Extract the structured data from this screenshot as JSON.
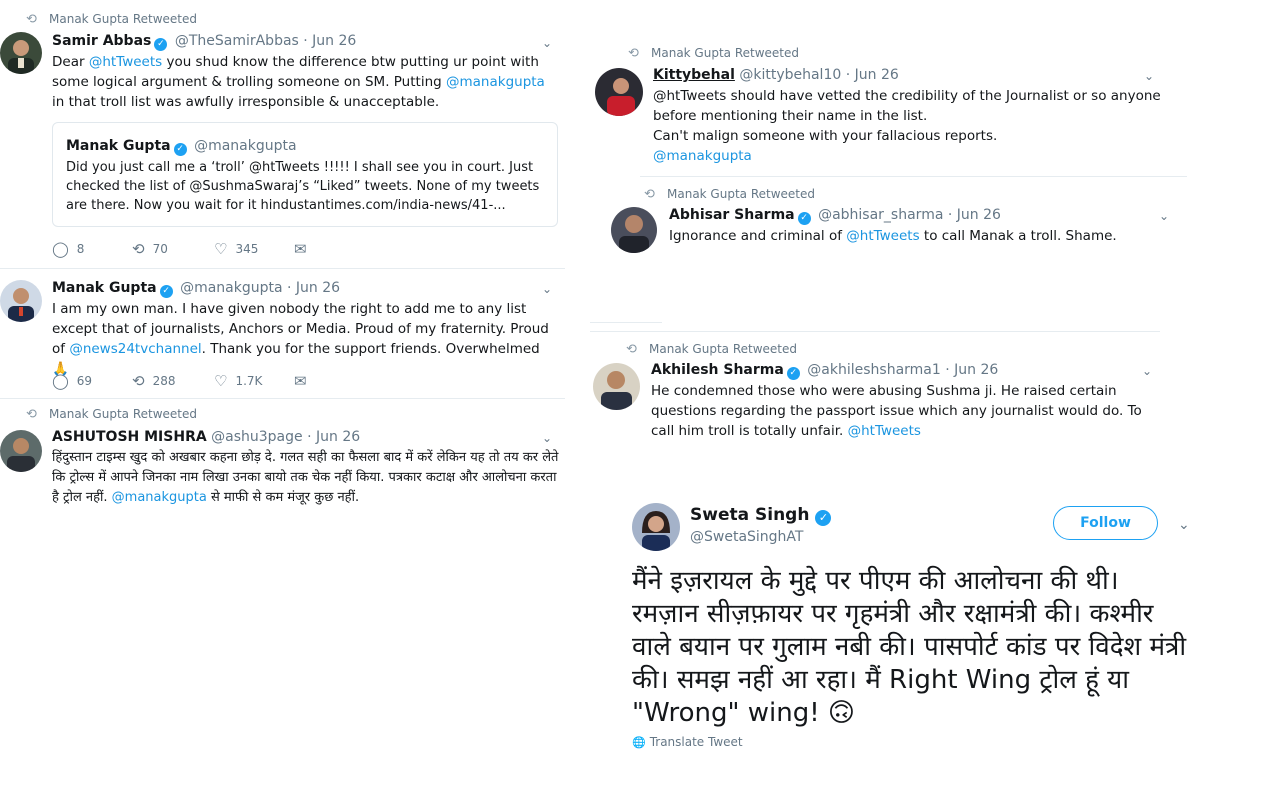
{
  "tweets": [
    {
      "retweet_label": "Manak Gupta Retweeted",
      "name": "Samir Abbas",
      "handle": "@TheSamirAbbas",
      "date": "· Jun 26",
      "text_parts": [
        "Dear ",
        "@htTweets",
        " you shud know the difference btw putting ur point with some logical argument & trolling someone on SM. Putting ",
        "@manakgupta",
        " in that troll list was awfully irresponsible & unacceptable."
      ],
      "quote": {
        "name": "Manak Gupta",
        "handle": "@manakgupta",
        "text": "Did you just call me a ‘troll’ @htTweets !!!!! I shall see you in court. Just checked the list of @SushmaSwaraj’s “Liked” tweets. None of my tweets are there. Now you wait for it  hindustantimes.com/india-news/41-..."
      },
      "replies": "8",
      "retweets": "70",
      "likes": "345"
    },
    {
      "name": "Manak Gupta",
      "handle": "@manakgupta",
      "date": "· Jun 26",
      "text_parts": [
        "I am my own man. I have given nobody the right to add me to any list except that of journalists, Anchors or Media. Proud of my fraternity. Proud of ",
        "@news24tvchannel",
        ". Thank you for the support friends. Overwhelmed 🙏"
      ],
      "replies": "69",
      "retweets": "288",
      "likes": "1.7K"
    },
    {
      "retweet_label": "Manak Gupta Retweeted",
      "name": "ASHUTOSH MISHRA",
      "handle": "@ashu3page",
      "date": "· Jun 26",
      "text_parts": [
        "हिंदुस्तान टाइम्स खुद को अखबार कहना छोड़ दे. गलत सही का फैसला बाद में करें लेकिन यह तो तय कर लेते कि ट्रोल्स में आपने जिनका नाम लिखा उनका बायो तक चेक नहीं किया. पत्रकार कटाक्ष और आलोचना करता है ट्रोल नहीं. ",
        "@manakgupta",
        " से माफी से कम मंजूर कुछ नहीं."
      ]
    },
    {
      "retweet_label": "Manak Gupta Retweeted",
      "name": "Kittybehal",
      "handle": "@kittybehal10",
      "date": "· Jun 26",
      "lines": [
        "@htTweets should have vetted the credibility of the Journalist or so anyone before mentioning their name in the list.",
        "Can't malign someone with your fallacious reports.",
        "@manakgupta"
      ]
    },
    {
      "retweet_label": "Manak Gupta Retweeted",
      "name": "Abhisar Sharma",
      "handle": "@abhisar_sharma",
      "date": "· Jun 26",
      "text_parts": [
        "Ignorance and criminal of ",
        "@htTweets",
        " to call Manak a troll. Shame."
      ]
    },
    {
      "retweet_label": "Manak Gupta Retweeted",
      "name": "Akhilesh Sharma",
      "handle": "@akhileshsharma1",
      "date": "· Jun 26",
      "text_parts": [
        "He condemned those who were abusing Sushma ji. He raised certain questions regarding the passport issue which any journalist would do. To call him troll is totally unfair. ",
        "@htTweets"
      ]
    }
  ],
  "sweta": {
    "name": "Sweta Singh",
    "handle": "@SwetaSinghAT",
    "follow_label": "Follow",
    "text": "मैंने इज़रायल के मुद्दे पर पीएम की आलोचना की थी। रमज़ान सीज़फ़ायर पर गृहमंत्री और रक्षामंत्री की। कश्मीर वाले बयान पर गुलाम नबी की। पासपोर्ट कांड पर विदेश मंत्री की। समझ नहीं आ रहा। मैं Right Wing ट्रोल हूं या \"Wrong\" wing! 🙃",
    "translate_label": "Translate Tweet"
  },
  "colors": {
    "link": "#1b95e0",
    "muted": "#657786",
    "verified": "#1da1f2"
  },
  "icons": [
    "retweet-icon",
    "verified-icon",
    "chevron-down-icon",
    "reply-icon",
    "like-icon",
    "mail-icon",
    "globe-icon"
  ]
}
